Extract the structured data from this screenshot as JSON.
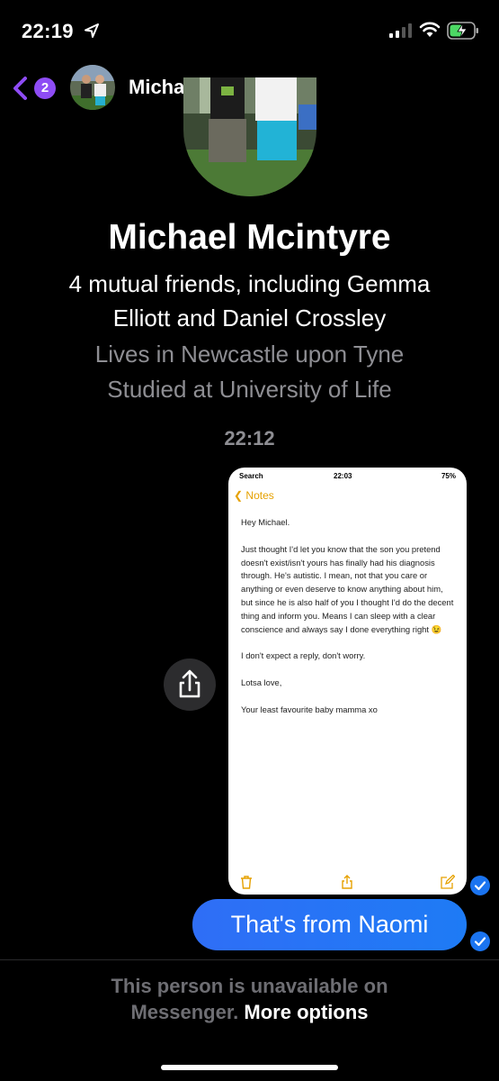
{
  "status_bar": {
    "time": "22:19"
  },
  "header": {
    "back_badge": "2",
    "name": "Michael Mcintyre"
  },
  "profile": {
    "name": "Michael Mcintyre",
    "mutual_line1": "4 mutual friends, including Gemma",
    "mutual_line2": "Elliott and Daniel Crossley",
    "lives": "Lives in Newcastle upon Tyne",
    "studied": "Studied at University of Life"
  },
  "conversation": {
    "timestamp": "22:12",
    "note_screenshot": {
      "status_left": "Search",
      "status_time": "22:03",
      "status_right": "75%",
      "back_label": "Notes",
      "paragraphs": [
        "Hey Michael.",
        "Just thought I'd let you know that the son you pretend doesn't exist/isn't yours  has finally had his diagnosis through. He's autistic. I mean, not that you care or anything or even deserve to know anything about him, but since he is also half of you I thought I'd do the decent thing and inform you. Means I can sleep with a clear conscience and always say I done everything right 😉",
        "I don't expect a reply, don't worry.",
        "Lotsa love,",
        "Your least favourite baby mamma xo"
      ]
    },
    "sent_message": "That's from Naomi"
  },
  "footer": {
    "unavailable_line1": "This person is unavailable on",
    "unavailable_line2": "Messenger.",
    "more_options": "More options"
  },
  "colors": {
    "accent_purple": "#8e4cf5",
    "bubble_blue": "#1e7bf5",
    "muted_gray": "#8e8e93",
    "notes_yellow": "#e6a100"
  }
}
